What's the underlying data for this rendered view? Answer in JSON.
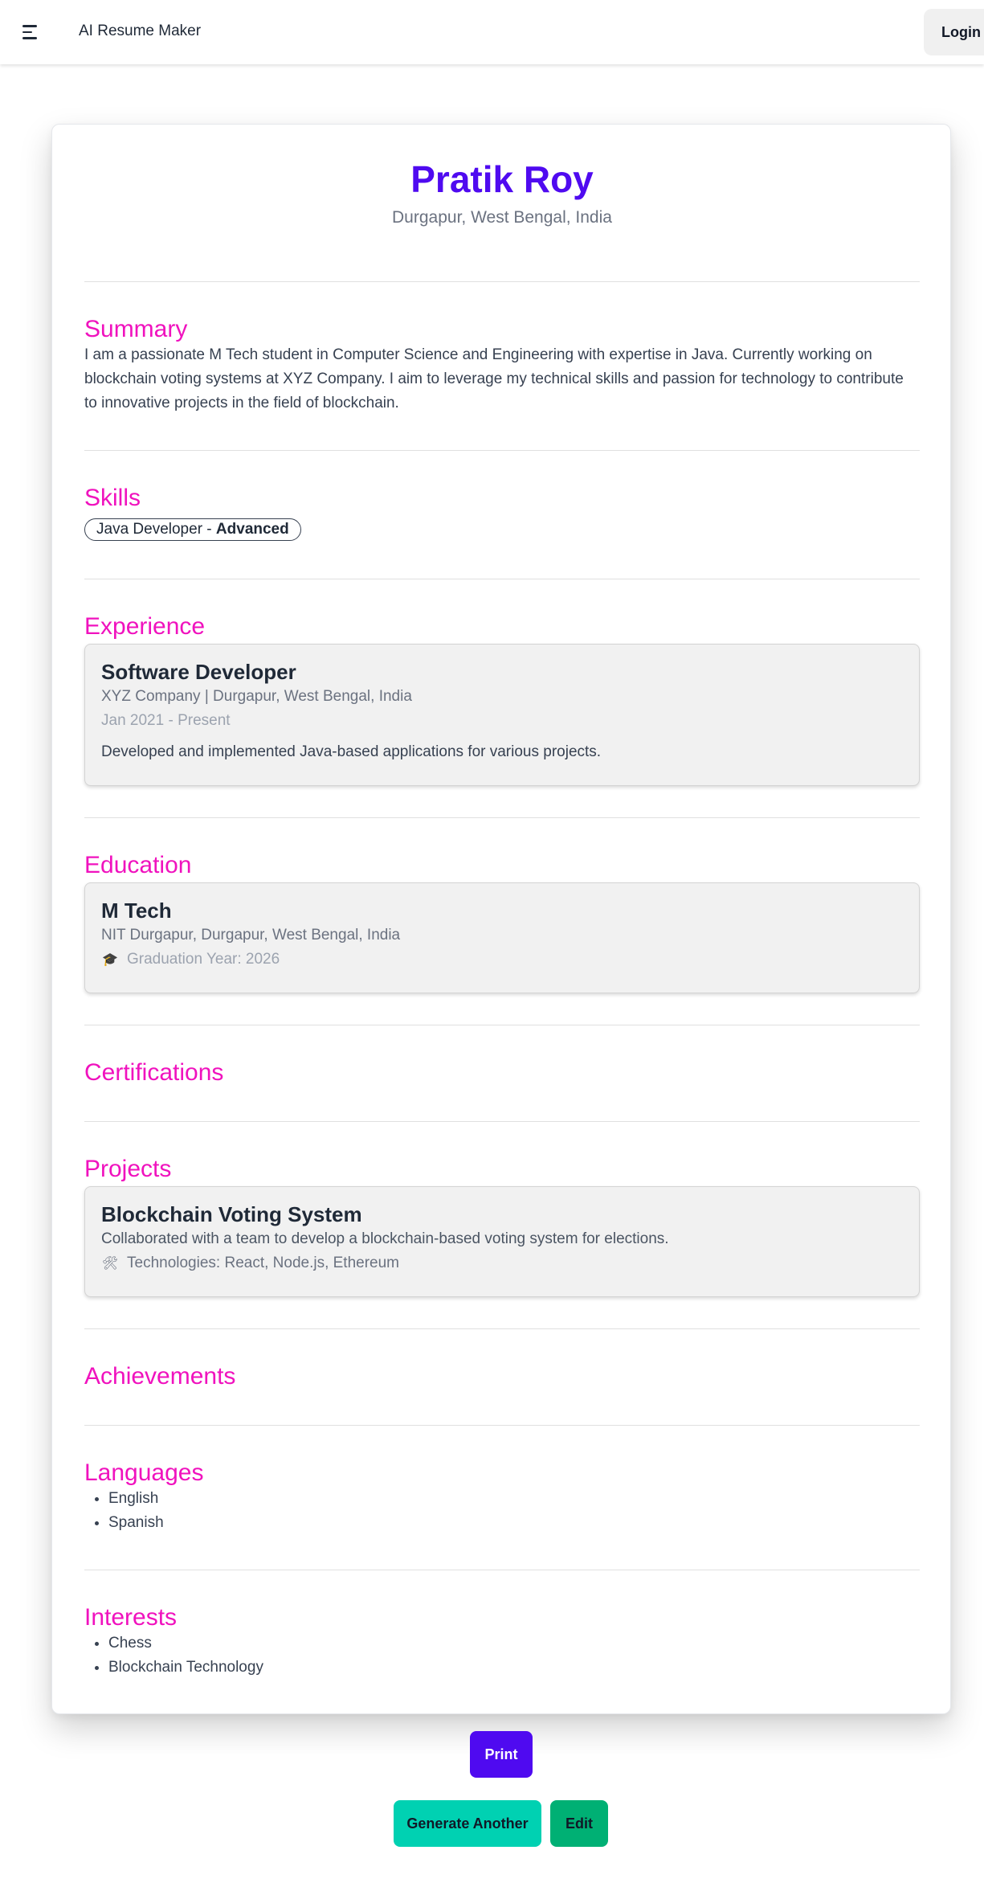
{
  "navbar": {
    "menu_icon": "hamburger-menu-icon",
    "brand": "AI Resume Maker",
    "login_label": "Login"
  },
  "resume": {
    "name": "Pratik Roy",
    "location": "Durgapur, West Bengal, India",
    "summary": {
      "title": "Summary",
      "text": "I am a passionate M Tech student in Computer Science and Engineering with expertise in Java. Currently working on blockchain voting systems at XYZ Company. I aim to leverage my technical skills and passion for technology to contribute to innovative projects in the field of blockchain."
    },
    "skills": {
      "title": "Skills",
      "items": [
        {
          "name": "Java Developer",
          "separator": " - ",
          "level": "Advanced"
        }
      ]
    },
    "experience": {
      "title": "Experience",
      "items": [
        {
          "role": "Software Developer",
          "company_location": "XYZ Company | Durgapur, West Bengal, India",
          "dates": "Jan 2021 - Present",
          "description": "Developed and implemented Java-based applications for various projects."
        }
      ]
    },
    "education": {
      "title": "Education",
      "items": [
        {
          "degree": "M Tech",
          "institution": "NIT Durgapur, Durgapur, West Bengal, India",
          "icon": "graduation-cap-icon",
          "graduation": "Graduation Year: 2026"
        }
      ]
    },
    "certifications": {
      "title": "Certifications"
    },
    "projects": {
      "title": "Projects",
      "items": [
        {
          "name": "Blockchain Voting System",
          "description": "Collaborated with a team to develop a blockchain-based voting system for elections.",
          "icon": "tools-icon",
          "technologies": "Technologies: React, Node.js, Ethereum"
        }
      ]
    },
    "achievements": {
      "title": "Achievements"
    },
    "languages": {
      "title": "Languages",
      "items": [
        "English",
        "Spanish"
      ]
    },
    "interests": {
      "title": "Interests",
      "items": [
        "Chess",
        "Blockchain Technology"
      ]
    }
  },
  "actions": {
    "print_label": "Print",
    "generate_label": "Generate Another",
    "edit_label": "Edit"
  },
  "colors": {
    "name": "#4f0af0",
    "section_title": "#f012be",
    "print_button": "#4f0af0",
    "generate_button": "#00d1b2",
    "edit_button": "#00b074"
  }
}
